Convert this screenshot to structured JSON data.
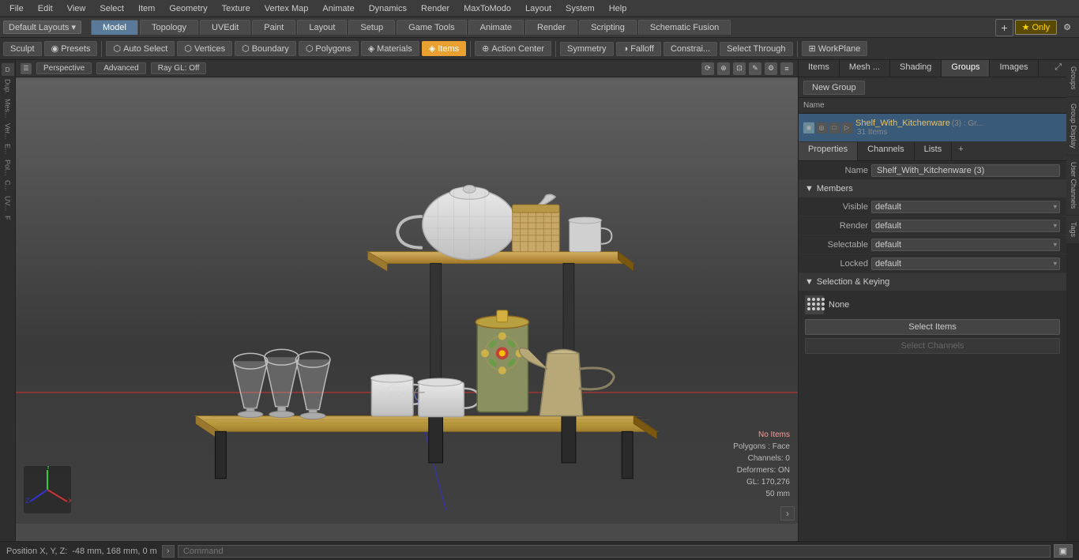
{
  "menubar": {
    "items": [
      "File",
      "Edit",
      "View",
      "Select",
      "Item",
      "Geometry",
      "Texture",
      "Vertex Map",
      "Animate",
      "Dynamics",
      "Render",
      "MaxToModo",
      "Layout",
      "System",
      "Help"
    ]
  },
  "layout_bar": {
    "layout_label": "Default Layouts ▾",
    "tabs": [
      "Model",
      "Topology",
      "UVEdit",
      "Paint",
      "Layout",
      "Setup",
      "Game Tools",
      "Animate",
      "Render",
      "Scripting",
      "Schematic Fusion"
    ],
    "active_tab": "Model",
    "star_label": "★ Only",
    "add_icon": "+"
  },
  "toolbar": {
    "sculpt": "Sculpt",
    "presets": "Presets",
    "auto_select": "Auto Select",
    "vertices": "Vertices",
    "boundary": "Boundary",
    "polygons": "Polygons",
    "materials": "Materials",
    "items": "Items",
    "action_center": "Action Center",
    "symmetry": "Symmetry",
    "falloff": "Falloff",
    "constraints": "Constrai...",
    "select_through": "Select Through",
    "workplane": "WorkPlane"
  },
  "viewport": {
    "perspective": "Perspective",
    "advanced": "Advanced",
    "ray_gl": "Ray GL: Off",
    "no_items": "No Items",
    "polygons_face": "Polygons : Face",
    "channels": "Channels: 0",
    "deformers": "Deformers: ON",
    "gl": "GL: 170,276",
    "mm": "50 mm"
  },
  "right_panel": {
    "tabs": [
      "Items",
      "Mesh ...",
      "Shading",
      "Groups",
      "Images"
    ],
    "active_tab": "Groups",
    "expand_icon": "⤢",
    "toolbar": {
      "new_group": "New Group"
    },
    "list_header": "Name",
    "list_items": [
      {
        "name": "Shelf_With_Kitchenware",
        "suffix": " (3) : Gr...",
        "count": "31 Items",
        "selected": true
      }
    ]
  },
  "properties": {
    "tabs": [
      "Properties",
      "Channels",
      "Lists",
      "+"
    ],
    "active_tab": "Properties",
    "name_label": "Name",
    "name_value": "Shelf_With_Kitchenware (3)",
    "members_label": "Members",
    "visible_label": "Visible",
    "visible_value": "default",
    "render_label": "Render",
    "render_value": "default",
    "selectable_label": "Selectable",
    "selectable_value": "default",
    "locked_label": "Locked",
    "locked_value": "default",
    "sk_section": "Selection & Keying",
    "sk_none": "None",
    "select_items_btn": "Select Items",
    "select_channels_btn": "Select Channels"
  },
  "vtabs": [
    "Groups",
    "Group Display",
    "User Channels",
    "Tags"
  ],
  "bottom": {
    "position_label": "Position X, Y, Z:",
    "position_value": "  -48 mm, 168 mm, 0 m",
    "command_placeholder": "Command",
    "arrow_btn": "›"
  }
}
